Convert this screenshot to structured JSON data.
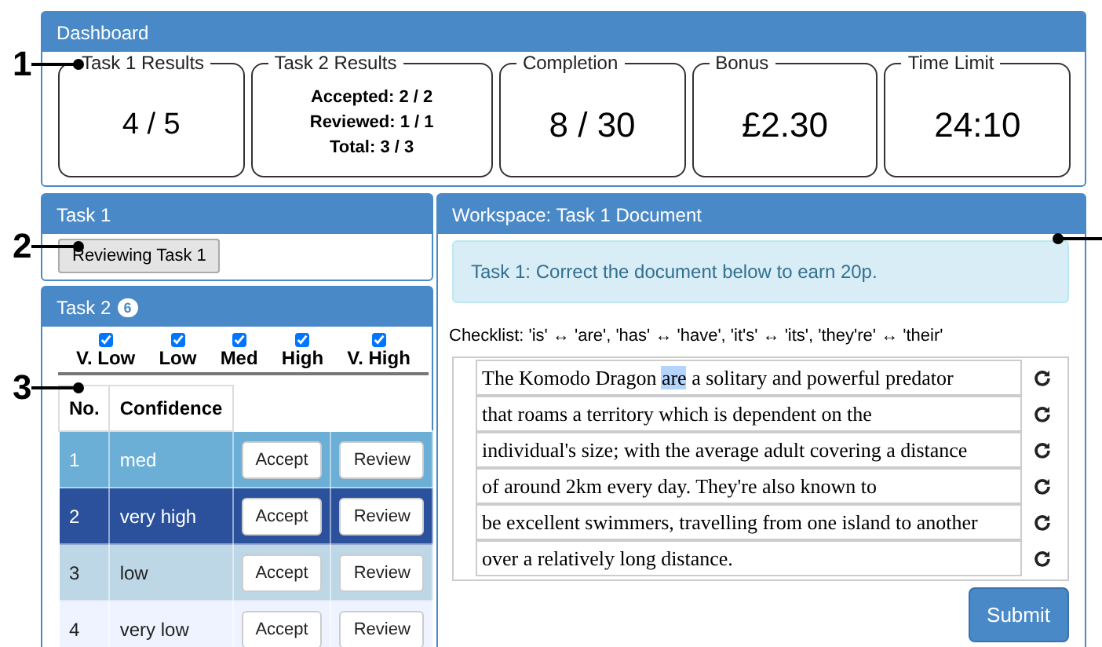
{
  "callouts": [
    {
      "label": "1"
    },
    {
      "label": "2"
    },
    {
      "label": "3"
    }
  ],
  "dashboard": {
    "title": "Dashboard",
    "cards": [
      {
        "kind": "value",
        "legend": "Task 1 Results",
        "value": "4 / 5"
      },
      {
        "kind": "lines",
        "legend": "Task 2 Results",
        "lines": [
          "Accepted: 2 / 2",
          "Reviewed: 1 / 1",
          "Total: 3 / 3"
        ]
      },
      {
        "kind": "big",
        "legend": "Completion",
        "value": "8 / 30"
      },
      {
        "kind": "big",
        "legend": "Bonus",
        "value": "£2.30"
      },
      {
        "kind": "big",
        "legend": "Time Limit",
        "value": "24:10"
      }
    ]
  },
  "task1": {
    "title": "Task 1",
    "button": "Reviewing Task 1"
  },
  "task2": {
    "title": "Task 2",
    "badge": "6",
    "filters": [
      {
        "label": "V. Low",
        "checked": true
      },
      {
        "label": "Low",
        "checked": true
      },
      {
        "label": "Med",
        "checked": true
      },
      {
        "label": "High",
        "checked": true
      },
      {
        "label": "V. High",
        "checked": true
      }
    ],
    "columns": [
      "No.",
      "Confidence"
    ],
    "rows": [
      {
        "no": "1",
        "confidence": "med",
        "color": "#6baed6",
        "accept": "Accept",
        "review": "Review"
      },
      {
        "no": "2",
        "confidence": "very high",
        "color": "#2b519c",
        "accept": "Accept",
        "review": "Review"
      },
      {
        "no": "3",
        "confidence": "low",
        "color": "#bdd7e7",
        "accept": "Accept",
        "review": "Review"
      },
      {
        "no": "4",
        "confidence": "very low",
        "color": "#eff3ff",
        "accept": "Accept",
        "review": "Review"
      }
    ]
  },
  "workspace": {
    "title": "Workspace: Task 1 Document",
    "info": "Task 1: Correct the document below to earn 20p.",
    "checklist": "Checklist: 'is' ↔ 'are', 'has' ↔ 'have', 'it's' ↔ 'its', 'they're' ↔ 'their'",
    "lines": [
      {
        "before": "The Komodo Dragon ",
        "selected_text": "are",
        "after": " a solitary and powerful predator"
      },
      {
        "before": "that roams a territory which is dependent on the"
      },
      {
        "before": "individual's size; with the average adult covering a distance"
      },
      {
        "before": "of around 2km every day. They're also known to"
      },
      {
        "before": "be excellent swimmers, travelling from one island to another"
      },
      {
        "before": "over a relatively long distance."
      }
    ],
    "submit": "Submit"
  }
}
